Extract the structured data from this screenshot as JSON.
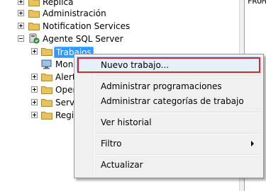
{
  "tree": {
    "items": [
      {
        "label": "Réplica",
        "expander": "plus"
      },
      {
        "label": "Administración",
        "expander": "plus"
      },
      {
        "label": "Notification Services",
        "expander": "plus"
      },
      {
        "label": "Agente SQL Server",
        "expander": "minus"
      },
      {
        "label": "Trabajos",
        "expander": "plus"
      },
      {
        "label": "Moni",
        "expander": "none"
      },
      {
        "label": "Alerta",
        "expander": "plus"
      },
      {
        "label": "Oper",
        "expander": "plus"
      },
      {
        "label": "Servic",
        "expander": "plus"
      },
      {
        "label": "Regis",
        "expander": "plus"
      }
    ]
  },
  "right_pane": {
    "text": "FROM"
  },
  "context_menu": {
    "items": [
      {
        "label": "Nuevo trabajo...",
        "highlighted": true
      },
      {
        "label": "Administrar programaciones"
      },
      {
        "label": "Administrar categorías de trabajo"
      },
      {
        "label": "Ver historial"
      },
      {
        "label": "Filtro",
        "has_submenu": true
      },
      {
        "label": "Actualizar"
      }
    ]
  },
  "colors": {
    "selection": "#3399ff",
    "highlight_border": "#d8262f",
    "folder": "#e8c25a"
  }
}
